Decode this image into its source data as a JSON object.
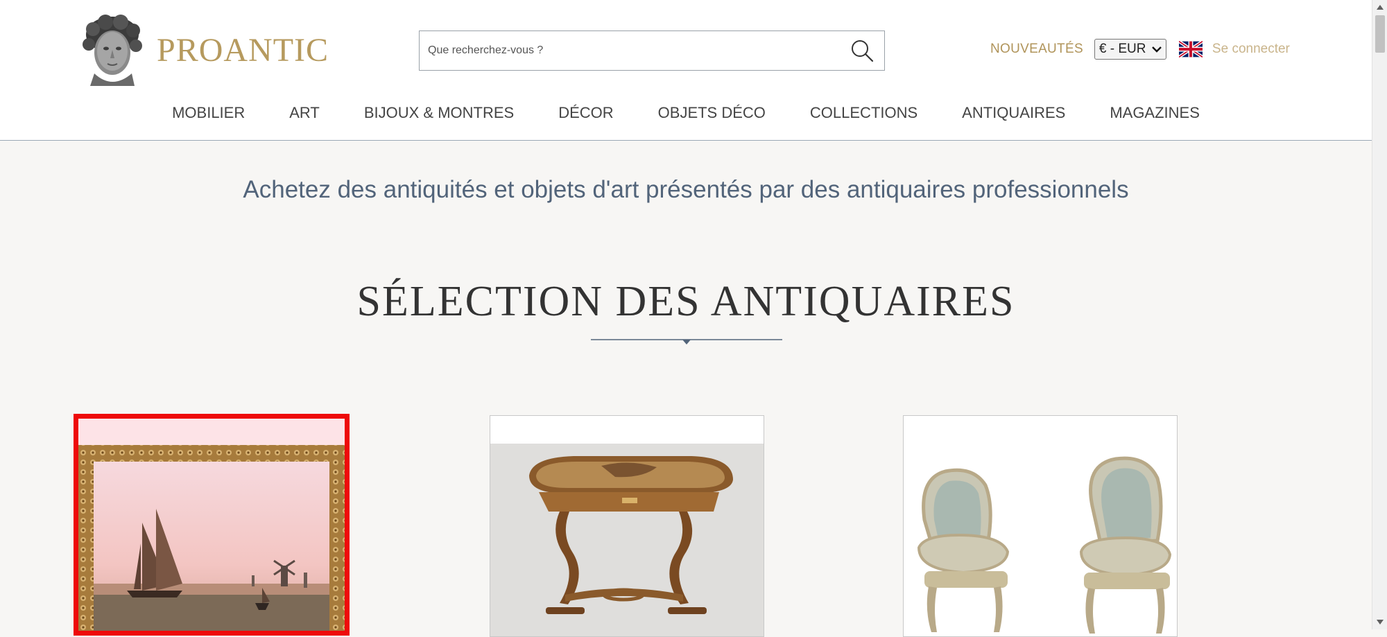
{
  "header": {
    "brand": "PROANTIC",
    "search": {
      "placeholder": "Que recherchez-vous ?"
    },
    "nouveautes": "NOUVEAUTÉS",
    "currency": "€ - EUR",
    "language_flag": "uk-flag-icon",
    "login": "Se connecter"
  },
  "nav": {
    "items": [
      {
        "label": "MOBILIER"
      },
      {
        "label": "ART"
      },
      {
        "label": "BIJOUX & MONTRES"
      },
      {
        "label": "DÉCOR"
      },
      {
        "label": "OBJETS DÉCO"
      },
      {
        "label": "COLLECTIONS"
      },
      {
        "label": "ANTIQUAIRES"
      },
      {
        "label": "MAGAZINES"
      }
    ]
  },
  "main": {
    "tagline": "Achetez des antiquités et objets d'art présentés par des antiquaires professionnels",
    "section_title": "SÉLECTION DES ANTIQUAIRES"
  },
  "colors": {
    "brand_gold": "#b69a5e",
    "tagline_blue": "#52647a",
    "selection_red": "#ee0a0a"
  }
}
